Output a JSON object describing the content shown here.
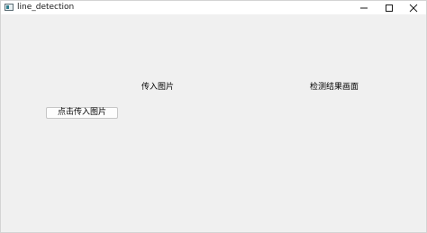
{
  "window": {
    "title": "line_detection",
    "icons": {
      "app": "app-window-icon",
      "minimize": "minimize-icon",
      "maximize": "maximize-icon",
      "close": "close-icon"
    }
  },
  "main": {
    "input_image_label": "传入图片",
    "result_label": "检测结果画面",
    "upload_button_label": "点击传入图片"
  }
}
